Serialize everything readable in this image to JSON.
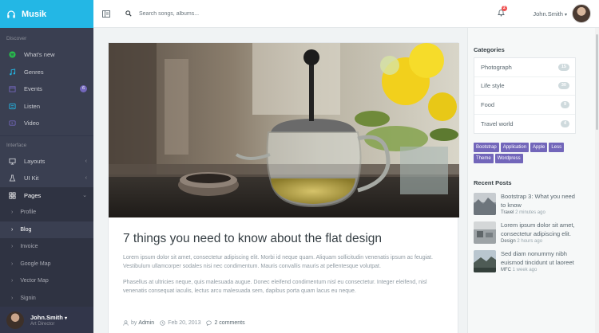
{
  "app": {
    "brand": "Musik"
  },
  "sidebar": {
    "discover_label": "Discover",
    "discover_items": [
      {
        "label": "What's new",
        "icon": "spotify-icon",
        "color": "#27c24c"
      },
      {
        "label": "Genres",
        "icon": "music-note-icon",
        "color": "#23b7e5"
      },
      {
        "label": "Events",
        "icon": "calendar-icon",
        "color": "#7266ba",
        "badge": "6"
      },
      {
        "label": "Listen",
        "icon": "list-icon",
        "color": "#23b7e5"
      },
      {
        "label": "Video",
        "icon": "video-icon",
        "color": "#7266ba"
      }
    ],
    "interface_label": "Interface",
    "interface_items": [
      {
        "label": "Layouts",
        "icon": "desktop-icon"
      },
      {
        "label": "UI Kit",
        "icon": "flask-icon"
      },
      {
        "label": "Pages",
        "icon": "grid-icon"
      }
    ],
    "pages_sub": [
      "Profile",
      "Blog",
      "Invoice",
      "Google Map",
      "Vector Map",
      "Signin"
    ],
    "user": {
      "name": "John.Smith",
      "role": "Art Director"
    }
  },
  "header": {
    "search_placeholder": "Search songs, albums...",
    "notifications": "2",
    "user_name": "John.Smith"
  },
  "article": {
    "title": "7 things you need to know about the flat design",
    "para1": "Lorem ipsum dolor sit amet, consectetur adipiscing elit. Morbi id neque quam. Aliquam sollicitudin venenatis ipsum ac feugiat. Vestibulum ullamcorper sodales nisi nec condimentum. Mauris convallis mauris at pellentesque volutpat.",
    "para2": "Phasellus at ultricies neque, quis malesuada augue. Donec eleifend condimentum nisl eu consectetur. Integer eleifend, nisl venenatis consequat iaculis, lectus arcu malesuada sem, dapibus porta quam lacus eu neque.",
    "by": "by",
    "author": "Admin",
    "date": "Feb 20, 2013",
    "comments": "2 comments"
  },
  "categories": {
    "heading": "Categories",
    "items": [
      {
        "label": "Photograph",
        "count": "15"
      },
      {
        "label": "Life style",
        "count": "30"
      },
      {
        "label": "Food",
        "count": "9"
      },
      {
        "label": "Travel world",
        "count": "4"
      }
    ]
  },
  "tags": [
    "Bootstrap",
    "Application",
    "Apple",
    "Less",
    "Theme",
    "Wordpress"
  ],
  "recent": {
    "heading": "Recent Posts",
    "items": [
      {
        "title": "Bootstrap 3: What you need to know",
        "cat": "Travel",
        "time": "2 minutes ago"
      },
      {
        "title": "Lorem ipsum dolor sit amet, consectetur adipiscing elit.",
        "cat": "Design",
        "time": "2 hours ago"
      },
      {
        "title": "Sed diam nonummy nibh euismod tincidunt ut laoreet",
        "cat": "MFC",
        "time": "1 week ago"
      }
    ]
  }
}
